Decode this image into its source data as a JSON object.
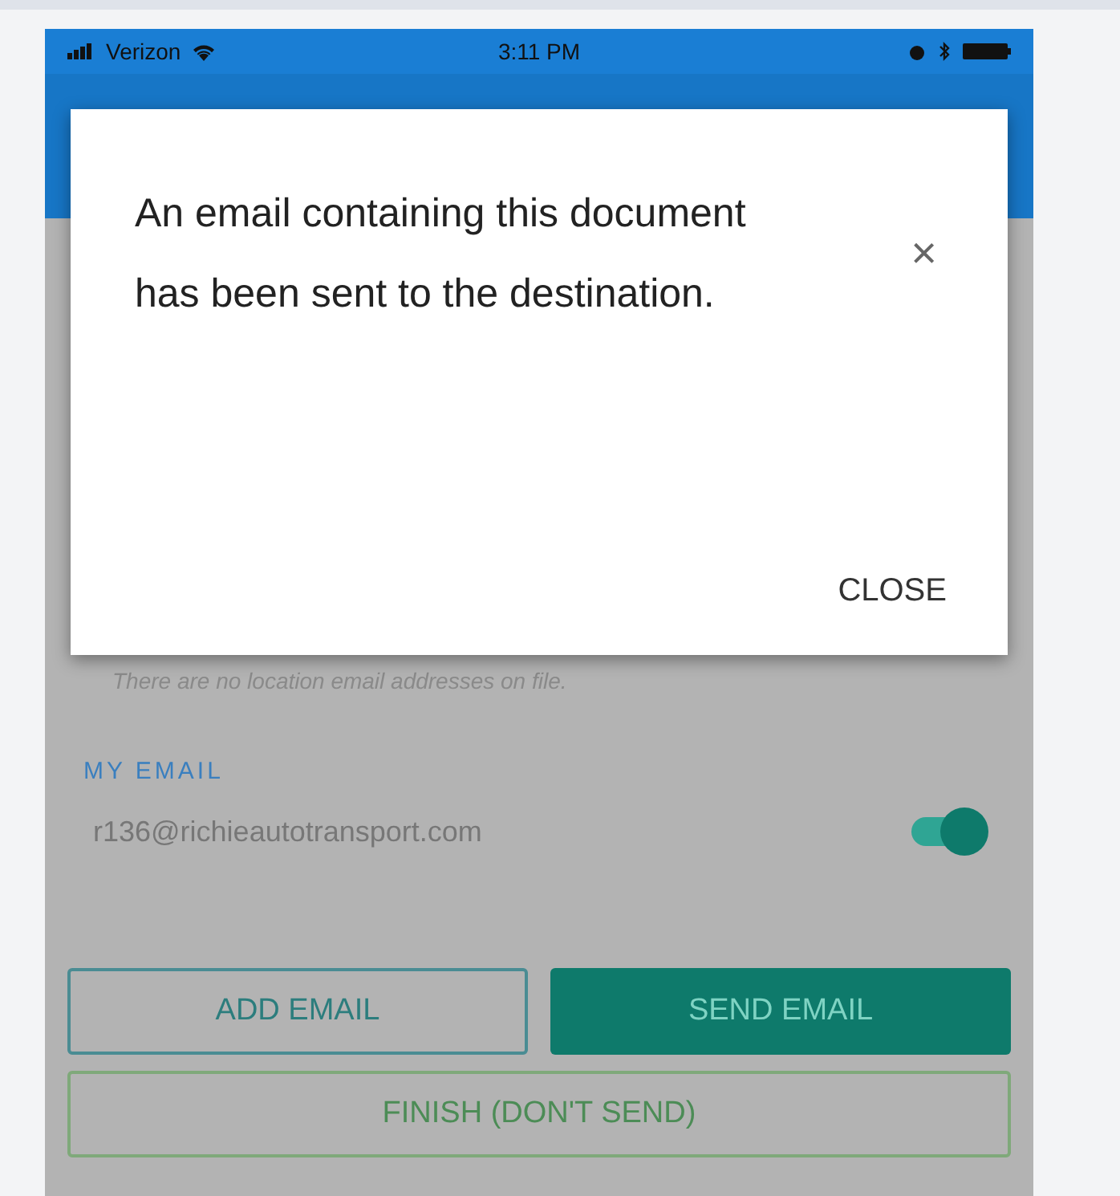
{
  "status_bar": {
    "carrier": "Verizon",
    "time": "3:11 PM"
  },
  "dialog": {
    "message": "An email containing this document has been sent to the destination.",
    "close_icon": "×",
    "action": "CLOSE"
  },
  "notice": "There are no location email addresses on file.",
  "my_email": {
    "label": "MY EMAIL",
    "address": "r136@richieautotransport.com",
    "on": true
  },
  "buttons": [
    {
      "label": "ADD EMAIL",
      "kind": "outline"
    },
    {
      "label": "SEND EMAIL",
      "kind": "filled"
    },
    {
      "label": "FINISH (DON'T SEND)",
      "kind": "finish"
    }
  ]
}
